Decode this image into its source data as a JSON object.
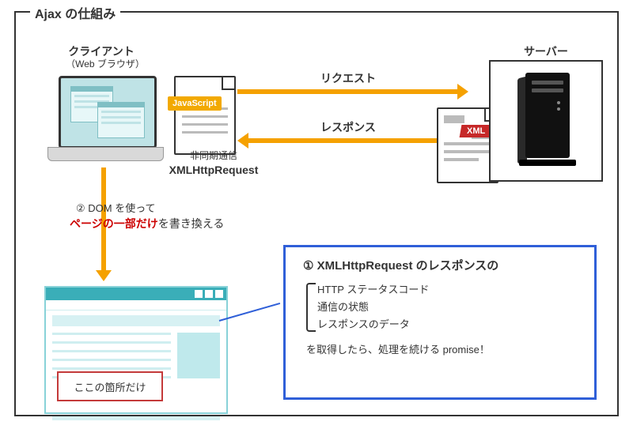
{
  "title": "Ajax の仕組み",
  "client": {
    "label": "クライアント",
    "sub": "（Web ブラウザ）"
  },
  "js_badge": "JavaScript",
  "js_caption_top": "非同期通信",
  "js_caption_bottom": "XMLHttpRequest",
  "arrow_request": "リクエスト",
  "arrow_response": "レスポンス",
  "xml_badge": "XML",
  "server_label": "サーバー",
  "dom_line1_prefix": "② DOM を使って",
  "dom_line2_red": "ページの一部だけ",
  "dom_line2_suffix": "を書き換える",
  "here_label": "ここの箇所だけ",
  "callout": {
    "title": "① XMLHttpRequest のレスポンスの",
    "items": [
      "HTTP ステータスコード",
      "通信の状態",
      "レスポンスのデータ"
    ],
    "footer": "を取得したら、処理を続ける promise！"
  }
}
